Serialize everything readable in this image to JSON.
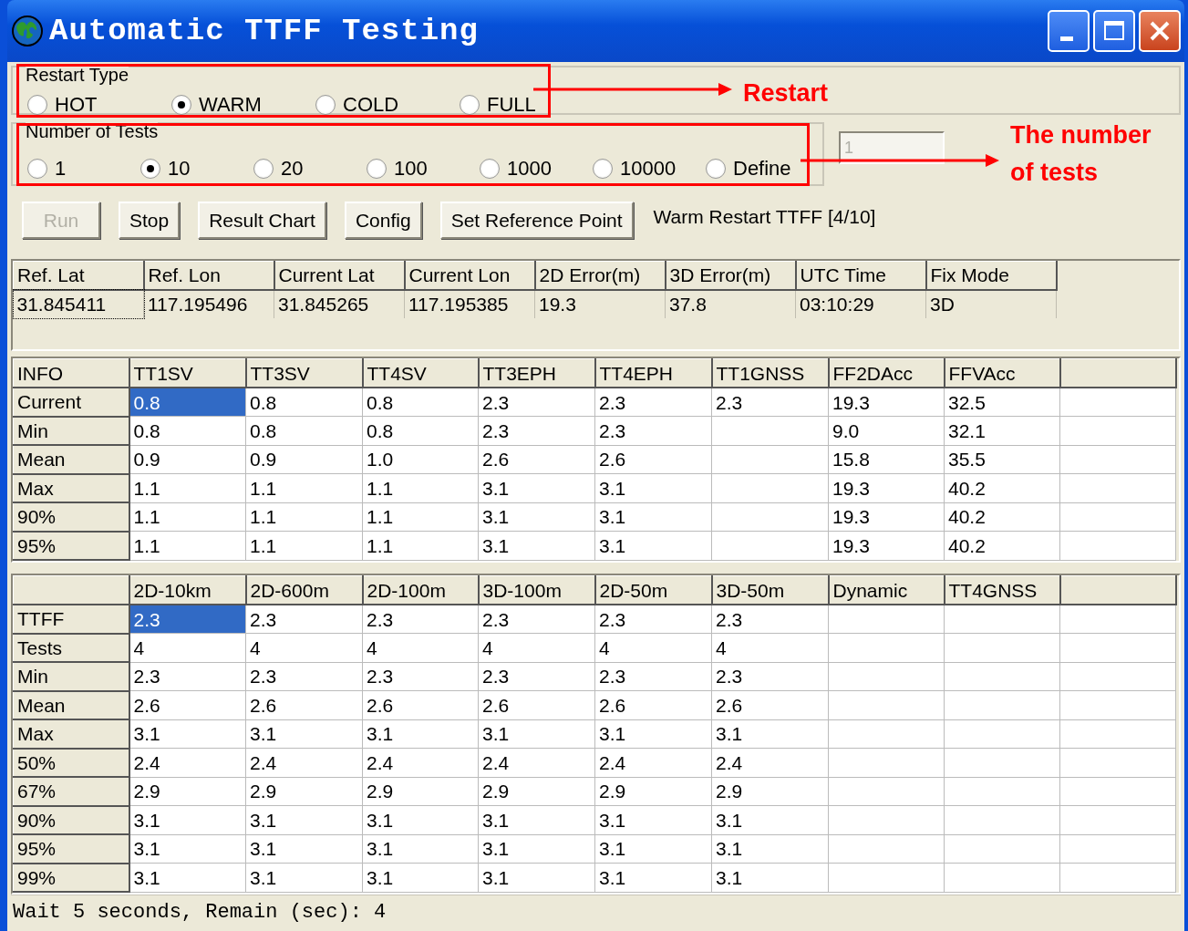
{
  "window": {
    "title": "Automatic TTFF Testing"
  },
  "restart_type": {
    "label": "Restart Type",
    "options": [
      {
        "label": "HOT",
        "selected": false
      },
      {
        "label": "WARM",
        "selected": true
      },
      {
        "label": "COLD",
        "selected": false
      },
      {
        "label": "FULL",
        "selected": false
      }
    ]
  },
  "number_of_tests": {
    "label": "Number of Tests",
    "options": [
      {
        "label": "1",
        "selected": false
      },
      {
        "label": "10",
        "selected": true
      },
      {
        "label": "20",
        "selected": false
      },
      {
        "label": "100",
        "selected": false
      },
      {
        "label": "1000",
        "selected": false
      },
      {
        "label": "10000",
        "selected": false
      },
      {
        "label": "Define",
        "selected": false
      }
    ],
    "define_value": "1",
    "define_disabled": true
  },
  "buttons": [
    {
      "label": "Run",
      "disabled": true
    },
    {
      "label": "Stop",
      "disabled": false
    },
    {
      "label": "Result Chart",
      "disabled": false
    },
    {
      "label": "Config",
      "disabled": false
    },
    {
      "label": "Set Reference Point",
      "disabled": false
    }
  ],
  "progress_text": "Warm Restart TTFF [4/10]",
  "position_table": {
    "columns": [
      "Ref. Lat",
      "Ref. Lon",
      "Current Lat",
      "Current Lon",
      "2D Error(m)",
      "3D Error(m)",
      "UTC Time",
      "Fix Mode"
    ],
    "rows": [
      [
        "31.845411",
        "117.195496",
        "31.845265",
        "117.195385",
        "19.3",
        "37.8",
        "03:10:29",
        "3D"
      ]
    ]
  },
  "stats_table": {
    "corner": "INFO",
    "columns": [
      "TT1SV",
      "TT3SV",
      "TT4SV",
      "TT3EPH",
      "TT4EPH",
      "TT1GNSS",
      "FF2DAcc",
      "FFVAcc"
    ],
    "rows": [
      {
        "label": "Current",
        "cells": [
          {
            "text": "0.8",
            "selected": true
          },
          {
            "text": "0.8",
            "selected": false
          },
          {
            "text": "0.8",
            "selected": false
          },
          {
            "text": "2.3",
            "selected": false
          },
          {
            "text": "2.3",
            "selected": false
          },
          {
            "text": "2.3",
            "selected": false
          },
          {
            "text": "19.3",
            "selected": false
          },
          {
            "text": "32.5",
            "selected": false
          }
        ]
      },
      {
        "label": "Min",
        "cells": [
          {
            "text": "0.8",
            "selected": false
          },
          {
            "text": "0.8",
            "selected": false
          },
          {
            "text": "0.8",
            "selected": false
          },
          {
            "text": "2.3",
            "selected": false
          },
          {
            "text": "2.3",
            "selected": false
          },
          {
            "selected": false
          },
          {
            "text": "9.0",
            "selected": false
          },
          {
            "text": "32.1",
            "selected": false
          }
        ]
      },
      {
        "label": "Mean",
        "cells": [
          {
            "text": "0.9",
            "selected": false
          },
          {
            "text": "0.9",
            "selected": false
          },
          {
            "text": "1.0",
            "selected": false
          },
          {
            "text": "2.6",
            "selected": false
          },
          {
            "text": "2.6",
            "selected": false
          },
          {
            "selected": false
          },
          {
            "text": "15.8",
            "selected": false
          },
          {
            "text": "35.5",
            "selected": false
          }
        ]
      },
      {
        "label": "Max",
        "cells": [
          {
            "text": "1.1",
            "selected": false
          },
          {
            "text": "1.1",
            "selected": false
          },
          {
            "text": "1.1",
            "selected": false
          },
          {
            "text": "3.1",
            "selected": false
          },
          {
            "text": "3.1",
            "selected": false
          },
          {
            "selected": false
          },
          {
            "text": "19.3",
            "selected": false
          },
          {
            "text": "40.2",
            "selected": false
          }
        ]
      },
      {
        "label": "90%",
        "cells": [
          {
            "text": "1.1",
            "selected": false
          },
          {
            "text": "1.1",
            "selected": false
          },
          {
            "text": "1.1",
            "selected": false
          },
          {
            "text": "3.1",
            "selected": false
          },
          {
            "text": "3.1",
            "selected": false
          },
          {
            "selected": false
          },
          {
            "text": "19.3",
            "selected": false
          },
          {
            "text": "40.2",
            "selected": false
          }
        ]
      },
      {
        "label": "95%",
        "cells": [
          {
            "text": "1.1",
            "selected": false
          },
          {
            "text": "1.1",
            "selected": false
          },
          {
            "text": "1.1",
            "selected": false
          },
          {
            "text": "3.1",
            "selected": false
          },
          {
            "text": "3.1",
            "selected": false
          },
          {
            "selected": false
          },
          {
            "text": "19.3",
            "selected": false
          },
          {
            "text": "40.2",
            "selected": false
          }
        ]
      }
    ]
  },
  "accuracy_table": {
    "columns": [
      "2D-10km",
      "2D-600m",
      "2D-100m",
      "3D-100m",
      "2D-50m",
      "3D-50m",
      "Dynamic",
      "TT4GNSS"
    ],
    "rows": [
      {
        "label": "TTFF",
        "cells": [
          {
            "text": "2.3",
            "selected": true
          },
          {
            "text": "2.3",
            "selected": false
          },
          {
            "text": "2.3",
            "selected": false
          },
          {
            "text": "2.3",
            "selected": false
          },
          {
            "text": "2.3",
            "selected": false
          },
          {
            "text": "2.3",
            "selected": false
          },
          {
            "selected": false
          },
          {
            "selected": false
          }
        ]
      },
      {
        "label": "Tests",
        "cells": [
          {
            "text": "4",
            "selected": false
          },
          {
            "text": "4",
            "selected": false
          },
          {
            "text": "4",
            "selected": false
          },
          {
            "text": "4",
            "selected": false
          },
          {
            "text": "4",
            "selected": false
          },
          {
            "text": "4",
            "selected": false
          },
          {
            "selected": false
          },
          {
            "selected": false
          }
        ]
      },
      {
        "label": "Min",
        "cells": [
          {
            "text": "2.3",
            "selected": false
          },
          {
            "text": "2.3",
            "selected": false
          },
          {
            "text": "2.3",
            "selected": false
          },
          {
            "text": "2.3",
            "selected": false
          },
          {
            "text": "2.3",
            "selected": false
          },
          {
            "text": "2.3",
            "selected": false
          },
          {
            "selected": false
          },
          {
            "selected": false
          }
        ]
      },
      {
        "label": "Mean",
        "cells": [
          {
            "text": "2.6",
            "selected": false
          },
          {
            "text": "2.6",
            "selected": false
          },
          {
            "text": "2.6",
            "selected": false
          },
          {
            "text": "2.6",
            "selected": false
          },
          {
            "text": "2.6",
            "selected": false
          },
          {
            "text": "2.6",
            "selected": false
          },
          {
            "selected": false
          },
          {
            "selected": false
          }
        ]
      },
      {
        "label": "Max",
        "cells": [
          {
            "text": "3.1",
            "selected": false
          },
          {
            "text": "3.1",
            "selected": false
          },
          {
            "text": "3.1",
            "selected": false
          },
          {
            "text": "3.1",
            "selected": false
          },
          {
            "text": "3.1",
            "selected": false
          },
          {
            "text": "3.1",
            "selected": false
          },
          {
            "selected": false
          },
          {
            "selected": false
          }
        ]
      },
      {
        "label": "50%",
        "cells": [
          {
            "text": "2.4",
            "selected": false
          },
          {
            "text": "2.4",
            "selected": false
          },
          {
            "text": "2.4",
            "selected": false
          },
          {
            "text": "2.4",
            "selected": false
          },
          {
            "text": "2.4",
            "selected": false
          },
          {
            "text": "2.4",
            "selected": false
          },
          {
            "selected": false
          },
          {
            "selected": false
          }
        ]
      },
      {
        "label": "67%",
        "cells": [
          {
            "text": "2.9",
            "selected": false
          },
          {
            "text": "2.9",
            "selected": false
          },
          {
            "text": "2.9",
            "selected": false
          },
          {
            "text": "2.9",
            "selected": false
          },
          {
            "text": "2.9",
            "selected": false
          },
          {
            "text": "2.9",
            "selected": false
          },
          {
            "selected": false
          },
          {
            "selected": false
          }
        ]
      },
      {
        "label": "90%",
        "cells": [
          {
            "text": "3.1",
            "selected": false
          },
          {
            "text": "3.1",
            "selected": false
          },
          {
            "text": "3.1",
            "selected": false
          },
          {
            "text": "3.1",
            "selected": false
          },
          {
            "text": "3.1",
            "selected": false
          },
          {
            "text": "3.1",
            "selected": false
          },
          {
            "selected": false
          },
          {
            "selected": false
          }
        ]
      },
      {
        "label": "95%",
        "cells": [
          {
            "text": "3.1",
            "selected": false
          },
          {
            "text": "3.1",
            "selected": false
          },
          {
            "text": "3.1",
            "selected": false
          },
          {
            "text": "3.1",
            "selected": false
          },
          {
            "text": "3.1",
            "selected": false
          },
          {
            "text": "3.1",
            "selected": false
          },
          {
            "selected": false
          },
          {
            "selected": false
          }
        ]
      },
      {
        "label": "99%",
        "cells": [
          {
            "text": "3.1",
            "selected": false
          },
          {
            "text": "3.1",
            "selected": false
          },
          {
            "text": "3.1",
            "selected": false
          },
          {
            "text": "3.1",
            "selected": false
          },
          {
            "text": "3.1",
            "selected": false
          },
          {
            "text": "3.1",
            "selected": false
          },
          {
            "selected": false
          },
          {
            "selected": false
          }
        ]
      }
    ]
  },
  "status_bar": {
    "text": "Wait 5 seconds, Remain (sec): 4"
  },
  "annotations": [
    {
      "text": "Restart"
    },
    {
      "text": "The number of tests"
    }
  ]
}
